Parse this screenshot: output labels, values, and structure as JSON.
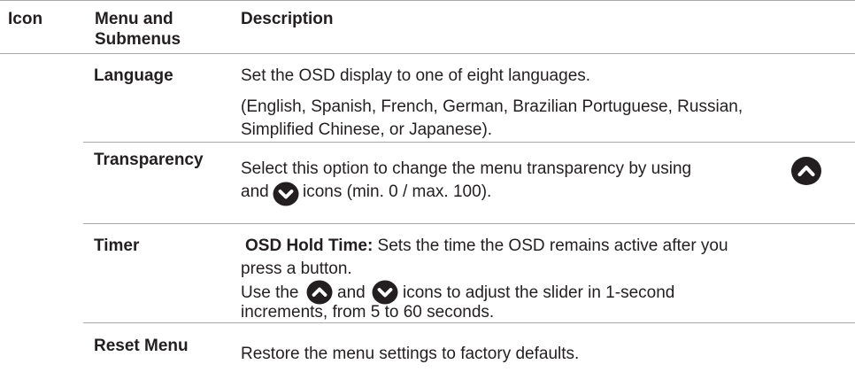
{
  "header": {
    "col_icon": "Icon",
    "col_menu_line1": "Menu and",
    "col_menu_line2": "Submenus",
    "col_description": "Description"
  },
  "rows": {
    "language": {
      "name": "Language",
      "desc1": "Set the OSD display to one of eight languages.",
      "desc2": "(English, Spanish, French, German, Brazilian Portuguese, Russian,",
      "desc3": "Simplified Chinese, or Japanese)."
    },
    "transparency": {
      "name": "Transparency",
      "desc1": "Select this option to change the menu transparency by using",
      "desc2_prefix": "and",
      "desc2_suffix": "icons (min. 0 / max. 100)."
    },
    "timer": {
      "name": "Timer",
      "desc1_bold": "OSD Hold Time:",
      "desc1_rest": " Sets the time the OSD remains active after you",
      "desc2": "press a button.",
      "desc3_prefix": "Use the",
      "desc3_mid": "and",
      "desc3_suffix": "icons to adjust the slider in 1-second",
      "desc4": "increments, from 5 to 60 seconds."
    },
    "reset": {
      "name": "Reset Menu",
      "desc1": "Restore the menu settings to factory defaults."
    }
  },
  "icons": {
    "up": "chevron-up-circle-icon",
    "down": "chevron-down-circle-icon"
  },
  "colors": {
    "rule": "#a7a9ac",
    "text": "#231f20",
    "icon_fill": "#231f20"
  }
}
